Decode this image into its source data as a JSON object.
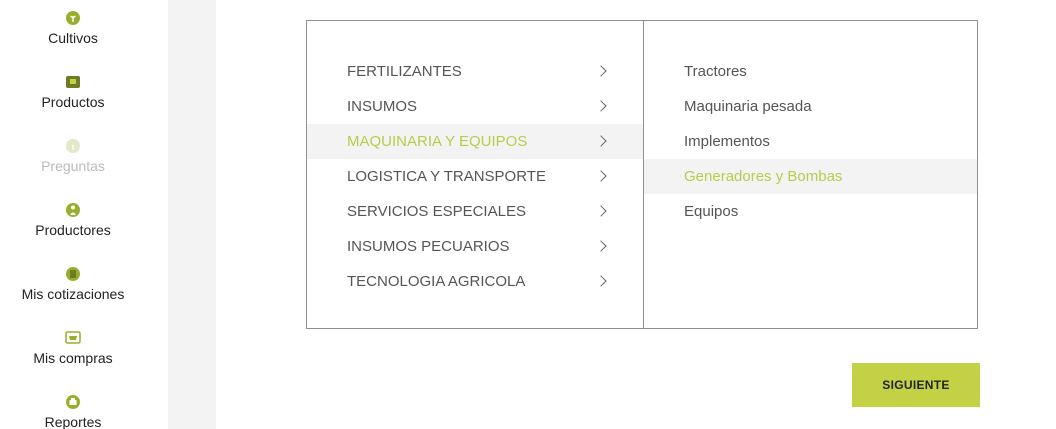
{
  "sidebar": {
    "items": [
      {
        "label": "Cultivos",
        "icon": "plant-icon",
        "disabled": false
      },
      {
        "label": "Productos",
        "icon": "box-icon",
        "disabled": false
      },
      {
        "label": "Preguntas",
        "icon": "question-icon",
        "disabled": true
      },
      {
        "label": "Productores",
        "icon": "farmer-icon",
        "disabled": false
      },
      {
        "label": "Mis cotizaciones",
        "icon": "document-icon",
        "disabled": false
      },
      {
        "label": "Mis compras",
        "icon": "cart-icon",
        "disabled": false
      },
      {
        "label": "Reportes",
        "icon": "print-icon",
        "disabled": false
      }
    ]
  },
  "categories": [
    {
      "label": "FERTILIZANTES",
      "active": false
    },
    {
      "label": "INSUMOS",
      "active": false
    },
    {
      "label": "MAQUINARIA Y EQUIPOS",
      "active": true
    },
    {
      "label": "LOGISTICA Y TRANSPORTE",
      "active": false
    },
    {
      "label": "SERVICIOS ESPECIALES",
      "active": false
    },
    {
      "label": "INSUMOS PECUARIOS",
      "active": false
    },
    {
      "label": "TECNOLOGIA AGRICOLA",
      "active": false
    }
  ],
  "subcategories": [
    {
      "label": "Tractores",
      "active": false
    },
    {
      "label": "Maquinaria pesada",
      "active": false
    },
    {
      "label": "Implementos",
      "active": false
    },
    {
      "label": "Generadores y Bombas",
      "active": true
    },
    {
      "label": "Equipos",
      "active": false
    }
  ],
  "actions": {
    "next_label": "SIGUIENTE"
  },
  "colors": {
    "accent": "#c3d245",
    "active_text": "#b8cc4a",
    "icon_green": "#9aae2e",
    "icon_olive": "#6f7a24",
    "disabled": "#bbbbbb"
  }
}
